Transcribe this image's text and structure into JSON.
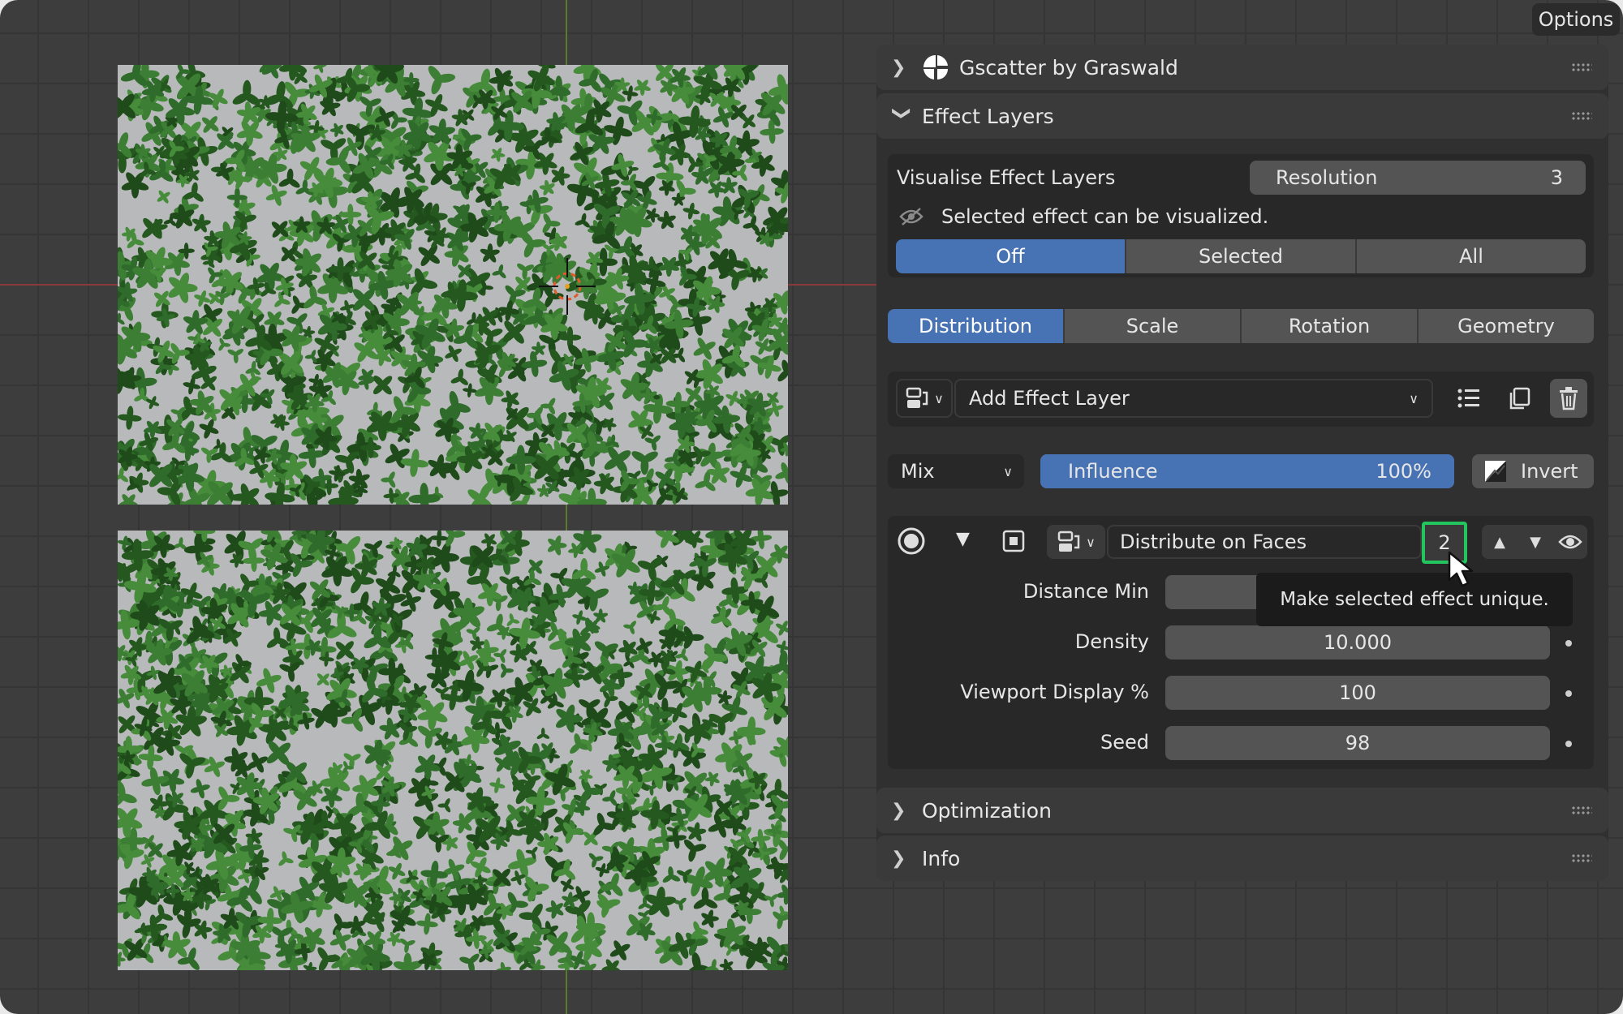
{
  "header": {
    "options_label": "Options"
  },
  "sections": {
    "gscatter": {
      "title": "Gscatter by Graswald",
      "collapsed": true
    },
    "effect_layers": {
      "title": "Effect Layers",
      "collapsed": false
    },
    "optimization": {
      "title": "Optimization",
      "collapsed": true
    },
    "info": {
      "title": "Info",
      "collapsed": true
    }
  },
  "visualise": {
    "label": "Visualise Effect Layers",
    "resolution_label": "Resolution",
    "resolution_value": "3",
    "hint": "Selected effect can be visualized.",
    "modes": [
      "Off",
      "Selected",
      "All"
    ],
    "active_mode": "Off"
  },
  "tabs": {
    "items": [
      "Distribution",
      "Scale",
      "Rotation",
      "Geometry"
    ],
    "active": "Distribution"
  },
  "add_layer": {
    "label": "Add Effect Layer"
  },
  "blend": {
    "mode": "Mix",
    "influence_label": "Influence",
    "influence_value": "100%",
    "influence_fraction": 1.0,
    "invert_label": "Invert"
  },
  "layer": {
    "name": "Distribute on Faces",
    "users": "2",
    "props": [
      {
        "label": "Distance Min",
        "value": ""
      },
      {
        "label": "Density",
        "value": "10.000"
      },
      {
        "label": "Viewport Display %",
        "value": "100"
      },
      {
        "label": "Seed",
        "value": "98"
      }
    ]
  },
  "tooltip": {
    "text": "Make selected effect unique."
  },
  "colors": {
    "accent": "#4772b3",
    "highlight": "#22c55e",
    "foliage": "#2f6b2a",
    "plane": "#b8b9bb"
  }
}
